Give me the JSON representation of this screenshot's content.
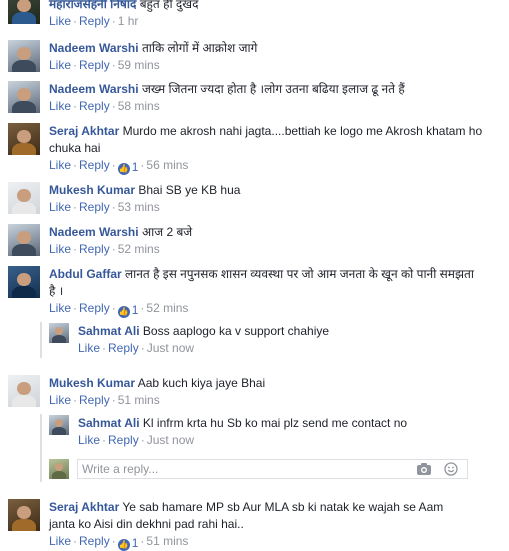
{
  "actions": {
    "like": "Like",
    "reply": "Reply",
    "separator": "·"
  },
  "comments": [
    {
      "name": "महाराजसेहनी निषाद",
      "text": "बहुत ही दुखद",
      "likes": "",
      "time": "1 hr"
    },
    {
      "name": "Nadeem Warshi",
      "text": "ताकि लोगों में आक्रोश जागे",
      "likes": "",
      "time": "59 mins"
    },
    {
      "name": "Nadeem Warshi",
      "text": "जख्म जितना ज्यदा होता है ।लोग उतना बढिया इलाज ढू नते हैं",
      "likes": "",
      "time": "58 mins"
    },
    {
      "name": "Seraj Akhtar",
      "text": "Murdo me akrosh nahi jagta....bettiah ke logo me Akrosh khatam ho chuka hai",
      "likes": "1",
      "time": "56 mins"
    },
    {
      "name": "Mukesh Kumar",
      "text": "Bhai SB ye KB hua",
      "likes": "",
      "time": "53 mins"
    },
    {
      "name": "Nadeem Warshi",
      "text": "आज 2 बजे",
      "likes": "",
      "time": "52 mins"
    },
    {
      "name": "Abdul Gaffar",
      "text": "लानत है इस नपुनसक शासन व्यवस्था पर जो आम जनता के खून को पानी समझता है ।",
      "likes": "1",
      "time": "52 mins"
    },
    {
      "name": "Mukesh Kumar",
      "text": "Aab kuch kiya jaye Bhai",
      "likes": "",
      "time": "51 mins"
    },
    {
      "name": "Seraj Akhtar",
      "text": "Ye sab hamare MP sb Aur MLA sb ki natak ke wajah se Aam janta ko Aisi din dekhni pad rahi hai..",
      "likes": "1",
      "time": "51 mins"
    }
  ],
  "replies": [
    {
      "name": "Sahmat Ali",
      "text": "Boss aaplogo ka v support chahiye",
      "time": "Just now"
    },
    {
      "name": "Sahmat Ali",
      "text": "Kl infrm krta hu Sb ko mai plz send me contact no",
      "time": "Just now"
    }
  ],
  "reply_box": {
    "placeholder": "Write a reply...",
    "camera_icon": "camera-icon",
    "emoji_icon": "smiley-icon"
  },
  "colors": {
    "name": "#365899",
    "link": "#4267b2",
    "meta": "#90949c"
  }
}
